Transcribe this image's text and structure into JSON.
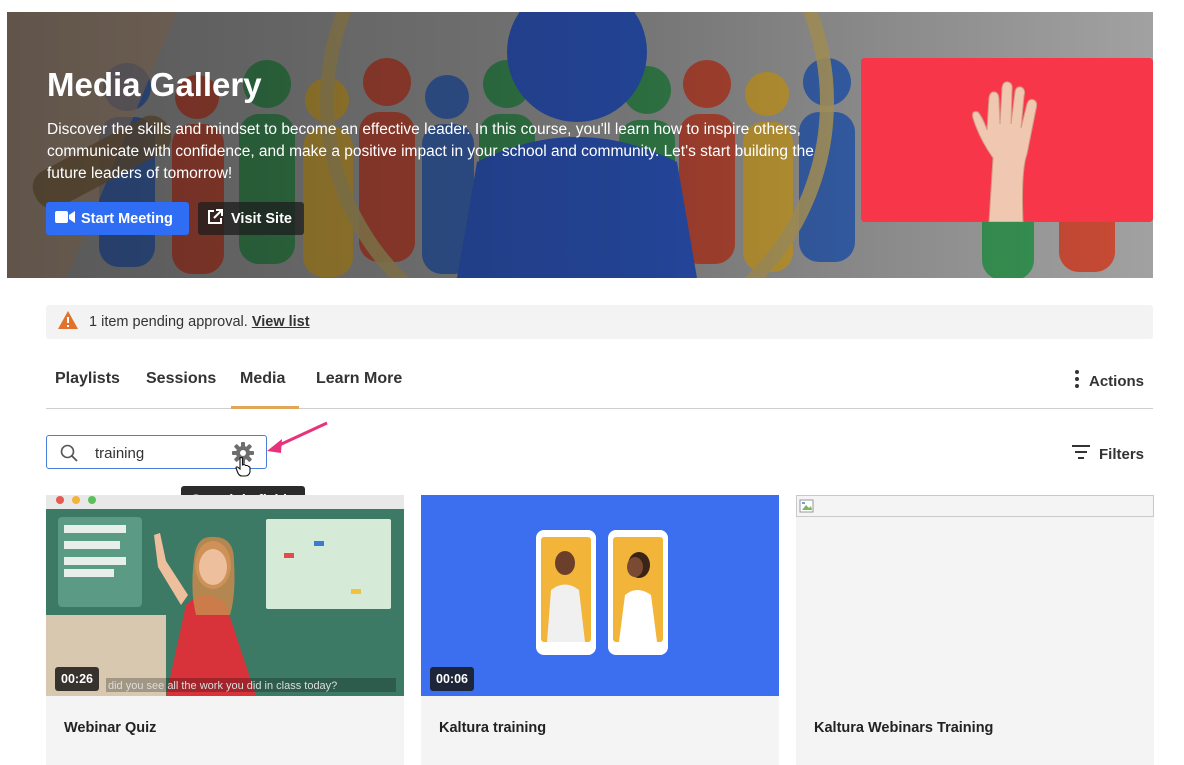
{
  "hero": {
    "title": "Media Gallery",
    "description": "Discover the skills and mindset to become an effective leader. In this course, you'll learn how to inspire others, communicate with confidence, and make a positive impact in your school and community. Let's start building the future leaders of tomorrow!",
    "start_meeting_label": "Start Meeting",
    "visit_site_label": "Visit Site"
  },
  "alert": {
    "text": "1 item pending approval.",
    "link": "View list"
  },
  "tabs": [
    {
      "label": "Playlists"
    },
    {
      "label": "Sessions"
    },
    {
      "label": "Media",
      "active": true
    },
    {
      "label": "Learn More"
    }
  ],
  "actions_label": "Actions",
  "search": {
    "value": "training",
    "tooltip": "Search in fields"
  },
  "filters_label": "Filters",
  "cards": [
    {
      "title": "Webinar Quiz",
      "duration": "00:26",
      "caption": "did you see all the work you did in class today?"
    },
    {
      "title": "Kaltura training",
      "duration": "00:06"
    },
    {
      "title": "Kaltura Webinars Training"
    }
  ],
  "colors": {
    "primary": "#2f6df5",
    "tab_underline": "#e0a75a",
    "warning": "#e0722c",
    "annotation_arrow": "#e8327a",
    "thumb_red": "#f7364a",
    "thumb_blue": "#3b6ff0"
  }
}
